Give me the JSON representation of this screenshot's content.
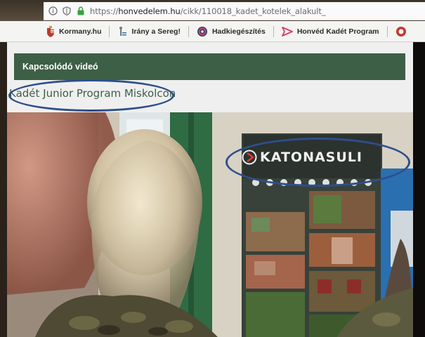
{
  "browser": {
    "url_prefix": "https://",
    "url_host": "honvedelem.hu",
    "url_path": "/cikk/110018_kadet_kotelek_alakult_",
    "icons": [
      "info-icon",
      "shield-icon",
      "lock-icon"
    ]
  },
  "bookmarks": [
    {
      "label": "Kormany.hu",
      "icon": "coat-of-arms-icon"
    },
    {
      "label": "Irány a Sereg!",
      "icon": "soldier-icon"
    },
    {
      "label": "Hadkiegészítés",
      "icon": "globe-icon"
    },
    {
      "label": "Honvéd Kadét Program",
      "icon": "arrow-flag-icon"
    }
  ],
  "section": {
    "header": "Kapcsolódó videó",
    "video_title": "Kadét Junior Program Miskolcon"
  },
  "video": {
    "banner_text": "KATONASULI"
  },
  "colors": {
    "header_green": "#3d5f46",
    "annotation_blue": "#2c4f8c"
  }
}
